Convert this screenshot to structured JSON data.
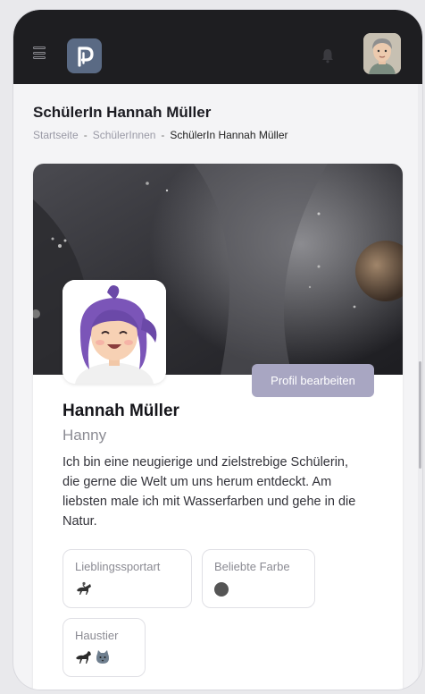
{
  "header": {
    "menu_icon": "hamburger-menu-icon",
    "logo_icon": "app-logo-icon",
    "notification_icon": "bell-icon",
    "avatar": "user-avatar"
  },
  "page": {
    "title": "SchülerIn Hannah Müller",
    "breadcrumb": [
      "Startseite",
      "SchülerInnen",
      "SchülerIn Hannah Müller"
    ],
    "separator": "-"
  },
  "profile": {
    "edit_button": "Profil bearbeiten",
    "name": "Hannah Müller",
    "nickname": "Hanny",
    "bio": "Ich bin eine neugierige und zielstrebige Schülerin, die gerne die Welt um uns herum entdeckt. Am liebsten male ich mit Wasserfarben und gehe in die Natur.",
    "attributes": [
      {
        "label": "Lieblingssportart",
        "value_icons": [
          "horse-riding-icon"
        ]
      },
      {
        "label": "Beliebte Farbe",
        "value_color": "#555555"
      },
      {
        "label": "Haustier",
        "value_icons": [
          "horse-icon",
          "cat-icon"
        ]
      }
    ]
  },
  "colors": {
    "topbar": "#1e1e21",
    "logo_bg": "#5a6a84",
    "edit_button_bg": "#a8a6c2",
    "favorite_color": "#555555"
  }
}
